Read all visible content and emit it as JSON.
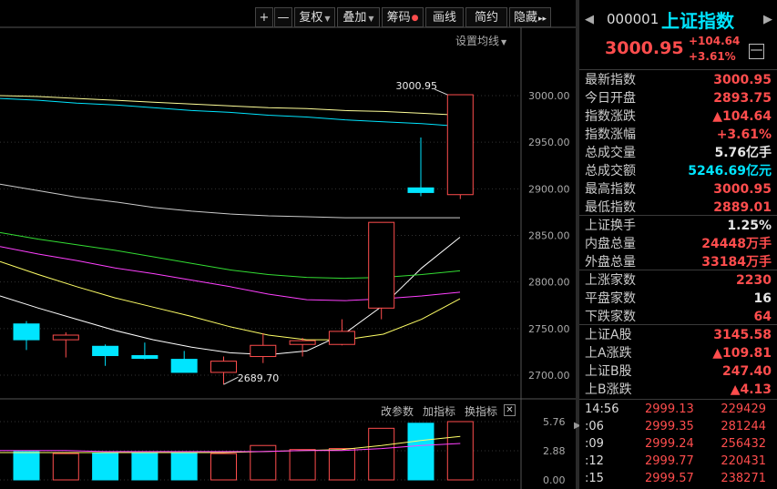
{
  "toolbar": {
    "zoom_in": "+",
    "zoom_out": "—",
    "adjust": "复权",
    "overlay": "叠加",
    "chips": "筹码",
    "draw": "画线",
    "simple": "简约",
    "hide": "隐藏",
    "more": "▸▸"
  },
  "settings_ma_label": "设置均线",
  "chart_data": {
    "type": "candlestick",
    "ylim": [
      2680,
      3010
    ],
    "yticks": [
      2700.0,
      2750.0,
      2800.0,
      2850.0,
      2900.0,
      2950.0,
      3000.0
    ],
    "annotations": [
      "3000.95",
      "2689.70"
    ],
    "candles": [
      {
        "o": 2755,
        "c": 2738,
        "h": 2758,
        "l": 2727,
        "up": false
      },
      {
        "o": 2743,
        "c": 2738,
        "h": 2746,
        "l": 2719,
        "up": true
      },
      {
        "o": 2731,
        "c": 2721,
        "h": 2733,
        "l": 2710,
        "up": false
      },
      {
        "o": 2721,
        "c": 2718,
        "h": 2735,
        "l": 2717,
        "up": false
      },
      {
        "o": 2717,
        "c": 2703,
        "h": 2726,
        "l": 2703,
        "up": false
      },
      {
        "o": 2703,
        "c": 2715,
        "h": 2720,
        "l": 2690,
        "up": true
      },
      {
        "o": 2720,
        "c": 2732,
        "h": 2745,
        "l": 2713,
        "up": true
      },
      {
        "o": 2733,
        "c": 2737,
        "h": 2740,
        "l": 2720,
        "up": true
      },
      {
        "o": 2733,
        "c": 2747,
        "h": 2760,
        "l": 2732,
        "up": true
      },
      {
        "o": 2772,
        "c": 2864,
        "h": 2864,
        "l": 2760,
        "up": true
      },
      {
        "o": 2901,
        "c": 2896,
        "h": 2955,
        "l": 2892,
        "up": false
      },
      {
        "o": 2893.75,
        "c": 3000.95,
        "h": 3000.95,
        "l": 2889.01,
        "up": true
      }
    ],
    "ma_series": [
      {
        "color": "#ffffff",
        "values": [
          2785,
          2772,
          2760,
          2748,
          2738,
          2730,
          2724,
          2722,
          2726,
          2745,
          2775,
          2815,
          2848
        ]
      },
      {
        "color": "#ffff66",
        "values": [
          2822,
          2808,
          2795,
          2783,
          2773,
          2763,
          2752,
          2743,
          2738,
          2738,
          2744,
          2760,
          2782
        ]
      },
      {
        "color": "#ff40ff",
        "values": [
          2838,
          2830,
          2823,
          2815,
          2809,
          2802,
          2795,
          2787,
          2781,
          2780,
          2782,
          2785,
          2789
        ]
      },
      {
        "color": "#33dd33",
        "values": [
          2853,
          2846,
          2840,
          2834,
          2827,
          2820,
          2813,
          2808,
          2805,
          2804,
          2805,
          2808,
          2812
        ]
      },
      {
        "color": "#cccccc",
        "values": [
          2905,
          2898,
          2891,
          2886,
          2880,
          2876,
          2873,
          2871,
          2870,
          2869,
          2869,
          2869,
          2869
        ]
      },
      {
        "color": "#00e5ff",
        "values": [
          2997,
          2995,
          2992,
          2990,
          2987,
          2984,
          2982,
          2979,
          2977,
          2974,
          2972,
          2970,
          2967
        ]
      },
      {
        "color": "#ffff99",
        "values": [
          3000,
          2999,
          2997,
          2995,
          2993,
          2991,
          2989,
          2987,
          2986,
          2984,
          2983,
          2981,
          2979
        ]
      }
    ],
    "volume": {
      "ylim": [
        0,
        5.76
      ],
      "yticks": [
        "5.76",
        "2.88",
        "0.00"
      ],
      "values": [
        2.8,
        2.6,
        2.7,
        2.7,
        2.7,
        2.6,
        3.4,
        3.0,
        3.1,
        5.1,
        5.6,
        5.76
      ],
      "ma_series": [
        {
          "color": "#ffff66",
          "values": [
            2.7,
            2.7,
            2.7,
            2.7,
            2.7,
            2.7,
            2.8,
            2.9,
            3.0,
            3.4,
            3.9,
            4.3
          ]
        },
        {
          "color": "#ff40ff",
          "values": [
            2.9,
            2.9,
            2.8,
            2.8,
            2.8,
            2.8,
            2.8,
            2.9,
            2.9,
            3.1,
            3.4,
            3.6
          ]
        }
      ]
    }
  },
  "sub_toolbar": {
    "change_params": "改参数",
    "add_indicator": "加指标",
    "swap_indicator": "换指标",
    "close": "✕"
  },
  "quote": {
    "code": "000001",
    "name": "上证指数",
    "nav_prev": "◀",
    "nav_next": "▶",
    "price": "3000.95",
    "change": "+104.64",
    "change_pct": "+3.61%",
    "minimize": "—",
    "rows": [
      {
        "label": "最新指数",
        "value": "3000.95",
        "color": "red"
      },
      {
        "label": "今日开盘",
        "value": "2893.75",
        "color": "red"
      },
      {
        "label": "指数涨跌",
        "value": "▲104.64",
        "color": "red"
      },
      {
        "label": "指数涨幅",
        "value": "+3.61%",
        "color": "red"
      },
      {
        "label": "总成交量",
        "value": "5.76亿手",
        "color": "wht"
      },
      {
        "label": "总成交额",
        "value": "5246.69亿元",
        "color": "cyn"
      },
      {
        "label": "最高指数",
        "value": "3000.95",
        "color": "red"
      },
      {
        "label": "最低指数",
        "value": "2889.01",
        "color": "red"
      },
      {
        "label": "上证换手",
        "value": "1.25%",
        "color": "wht"
      },
      {
        "label": "内盘总量",
        "value": "24448万手",
        "color": "red"
      },
      {
        "label": "外盘总量",
        "value": "33184万手",
        "color": "red"
      },
      {
        "label": "上涨家数",
        "value": "2230",
        "color": "red"
      },
      {
        "label": "平盘家数",
        "value": "16",
        "color": "wht"
      },
      {
        "label": "下跌家数",
        "value": "64",
        "color": "red"
      },
      {
        "label": "上证A股",
        "value": "3145.58",
        "color": "red"
      },
      {
        "label": "上A涨跌",
        "value": "▲109.81",
        "color": "red"
      },
      {
        "label": "上证B股",
        "value": "247.40",
        "color": "red"
      },
      {
        "label": "上B涨跌",
        "value": "▲4.13",
        "color": "red"
      }
    ],
    "ticks": [
      {
        "time": "14:56",
        "price": "2999.13",
        "vol": "229429"
      },
      {
        "time": ":06",
        "price": "2999.35",
        "vol": "281244"
      },
      {
        "time": ":09",
        "price": "2999.24",
        "vol": "256432"
      },
      {
        "time": ":12",
        "price": "2999.77",
        "vol": "220431"
      },
      {
        "time": ":15",
        "price": "2999.57",
        "vol": "238271"
      }
    ]
  },
  "colors": {
    "up": "#ff4d4d",
    "down": "#00e5ff",
    "grid": "#333333",
    "bg": "#000000"
  }
}
